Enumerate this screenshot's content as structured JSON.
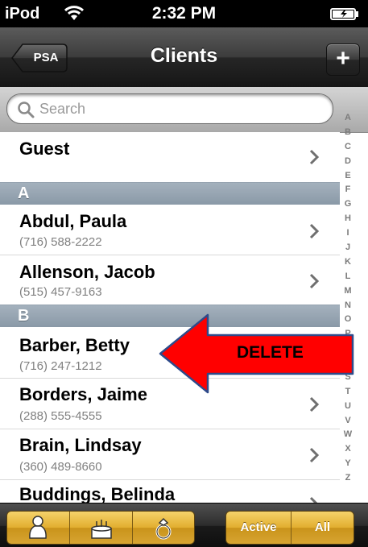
{
  "status_bar": {
    "carrier": "iPod",
    "time": "2:32 PM",
    "wifi_icon": "wifi-icon",
    "battery_icon": "battery-icon"
  },
  "nav": {
    "back_label": "PSA",
    "title": "Clients",
    "add_label": "+"
  },
  "search": {
    "placeholder": "Search",
    "value": ""
  },
  "list": {
    "guest": {
      "name": "Guest"
    },
    "section_a": {
      "letter": "A"
    },
    "section_b": {
      "letter": "B"
    },
    "rows": [
      {
        "name": "Abdul, Paula",
        "phone": "(716) 588-2222"
      },
      {
        "name": "Allenson, Jacob",
        "phone": "(515) 457-9163"
      },
      {
        "name": "Barber, Betty",
        "phone": "(716) 247-1212"
      },
      {
        "name": "Borders, Jaime",
        "phone": "(288) 555-4555"
      },
      {
        "name": "Brain, Lindsay",
        "phone": "(360) 489-8660"
      },
      {
        "name": "Buddings, Belinda",
        "phone": ""
      }
    ]
  },
  "alpha_index": [
    "A",
    "B",
    "C",
    "D",
    "E",
    "F",
    "G",
    "H",
    "I",
    "J",
    "K",
    "L",
    "M",
    "N",
    "O",
    "P",
    "Q",
    "R",
    "S",
    "T",
    "U",
    "V",
    "W",
    "X",
    "Y",
    "Z"
  ],
  "toolbar": {
    "icons": [
      "person-icon",
      "cake-icon",
      "ring-icon"
    ],
    "filter_active": "Active",
    "filter_all": "All"
  },
  "annotation": {
    "label": "DELETE",
    "color": "#ff0000",
    "text_color": "#000000"
  },
  "colors": {
    "nav_bar": "#2a2a2a",
    "section_header": "#97a6b4",
    "toolbar_gold": "#e0aa30"
  }
}
